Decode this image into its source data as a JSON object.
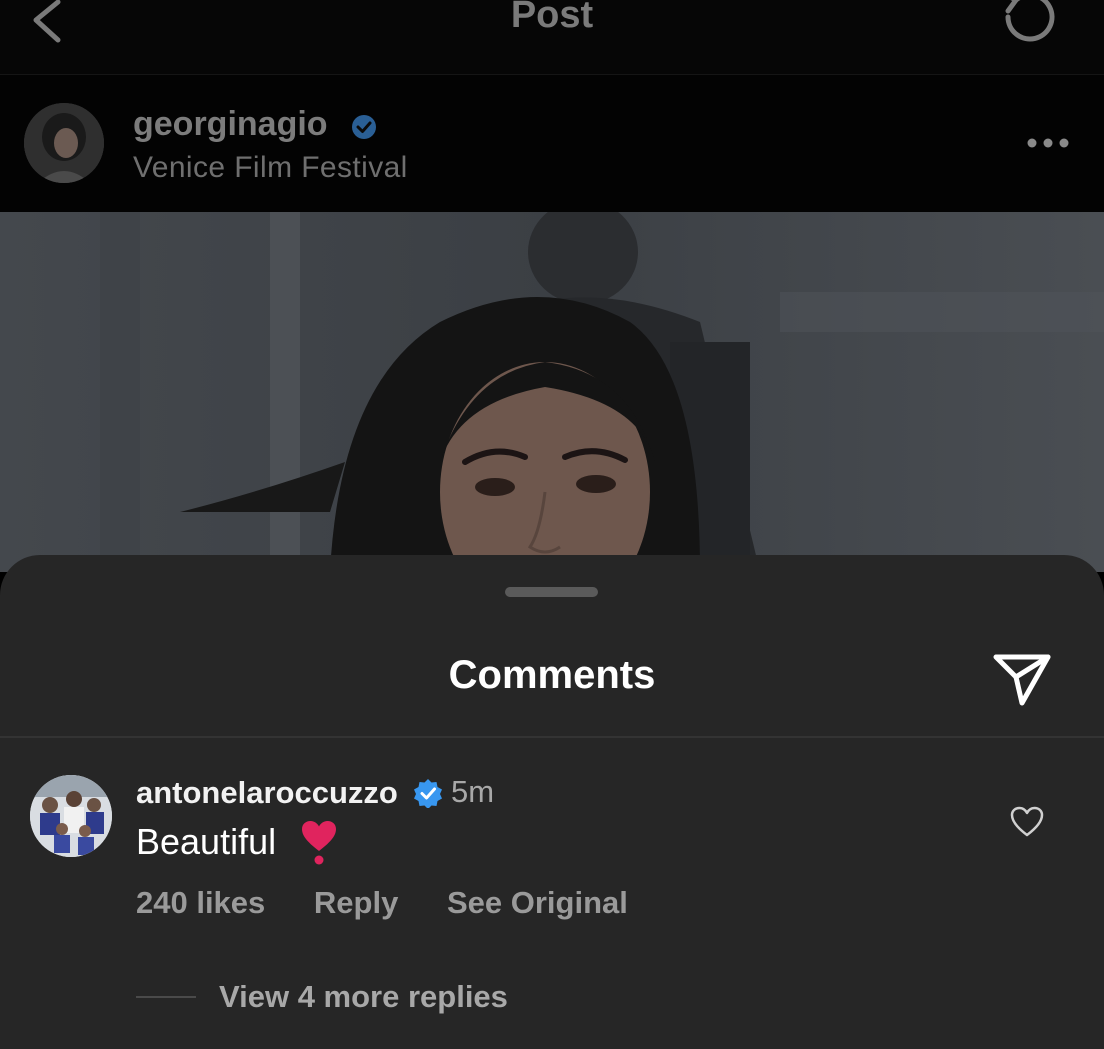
{
  "nav": {
    "title": "Post",
    "back_icon": "chevron-left-icon",
    "refresh_icon": "refresh-icon"
  },
  "post": {
    "username": "georginagio",
    "location": "Venice Film Festival",
    "verified_icon": "verified-badge-icon",
    "more_icon": "more-horizontal-icon"
  },
  "comments_sheet": {
    "title": "Comments",
    "share_icon": "send-icon",
    "comment": {
      "username": "antonelaroccuzzo",
      "time": "5m",
      "text": "Beautiful",
      "emoji": "heart-exclamation-icon",
      "likes": "240 likes",
      "reply_label": "Reply",
      "see_original_label": "See Original",
      "like_icon": "heart-outline-icon"
    },
    "view_replies": "View 4 more replies"
  },
  "colors": {
    "sheet_bg": "#262626",
    "verified": "#3897f0",
    "heart_emoji": "#e0245e"
  }
}
